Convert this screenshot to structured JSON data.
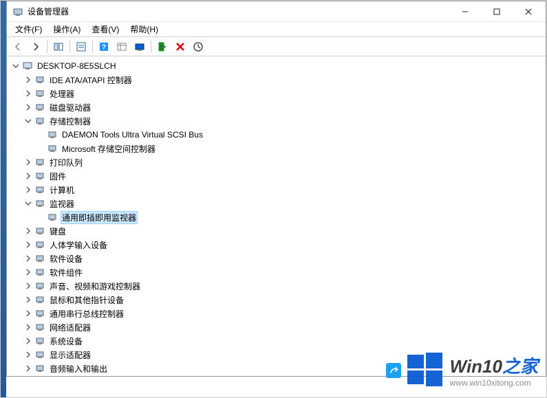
{
  "window": {
    "title": "设备管理器"
  },
  "menu": {
    "file": "文件(F)",
    "action": "操作(A)",
    "view": "查看(V)",
    "help": "帮助(H)"
  },
  "toolbar_icons": {
    "back": "back-icon",
    "forward": "forward-icon",
    "show_hide": "show-hide-icon",
    "properties": "properties-icon",
    "help": "help-icon",
    "details": "details-icon",
    "scan": "scan-icon",
    "add": "add-icon",
    "remove": "remove-icon",
    "update": "update-icon"
  },
  "tree": {
    "root": "DESKTOP-8E5SLCH",
    "items": [
      {
        "label": "IDE ATA/ATAPI 控制器",
        "exp": "collapsed",
        "depth": 1
      },
      {
        "label": "处理器",
        "exp": "collapsed",
        "depth": 1
      },
      {
        "label": "磁盘驱动器",
        "exp": "collapsed",
        "depth": 1
      },
      {
        "label": "存储控制器",
        "exp": "expanded",
        "depth": 1
      },
      {
        "label": "DAEMON Tools Ultra Virtual SCSI Bus",
        "exp": "none",
        "depth": 2
      },
      {
        "label": "Microsoft 存储空间控制器",
        "exp": "none",
        "depth": 2
      },
      {
        "label": "打印队列",
        "exp": "collapsed",
        "depth": 1
      },
      {
        "label": "固件",
        "exp": "collapsed",
        "depth": 1
      },
      {
        "label": "计算机",
        "exp": "collapsed",
        "depth": 1
      },
      {
        "label": "监视器",
        "exp": "expanded",
        "depth": 1
      },
      {
        "label": "通用即插即用监视器",
        "exp": "none",
        "depth": 2,
        "selected": true
      },
      {
        "label": "键盘",
        "exp": "collapsed",
        "depth": 1
      },
      {
        "label": "人体学输入设备",
        "exp": "collapsed",
        "depth": 1
      },
      {
        "label": "软件设备",
        "exp": "collapsed",
        "depth": 1
      },
      {
        "label": "软件组件",
        "exp": "collapsed",
        "depth": 1
      },
      {
        "label": "声音、视频和游戏控制器",
        "exp": "collapsed",
        "depth": 1
      },
      {
        "label": "鼠标和其他指针设备",
        "exp": "collapsed",
        "depth": 1
      },
      {
        "label": "通用串行总线控制器",
        "exp": "collapsed",
        "depth": 1
      },
      {
        "label": "网络适配器",
        "exp": "collapsed",
        "depth": 1
      },
      {
        "label": "系统设备",
        "exp": "collapsed",
        "depth": 1
      },
      {
        "label": "显示适配器",
        "exp": "collapsed",
        "depth": 1
      },
      {
        "label": "音频输入和输出",
        "exp": "collapsed",
        "depth": 1
      }
    ]
  },
  "watermark": {
    "title_main": "Win10",
    "title_suffix": "之家",
    "url": "www.win10xitong.com"
  }
}
